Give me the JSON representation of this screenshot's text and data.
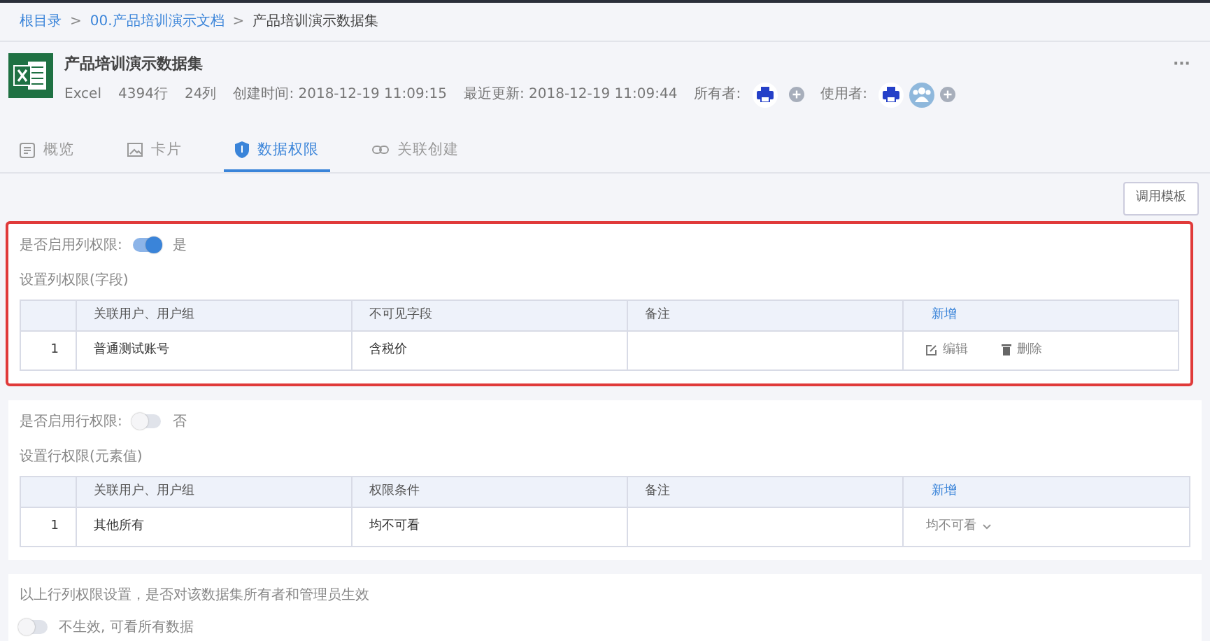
{
  "breadcrumb": [
    {
      "label": "根目录",
      "link": true
    },
    {
      "label": "00.产品培训演示文档",
      "link": true
    },
    {
      "label": "产品培训演示数据集",
      "link": false
    }
  ],
  "breadcrumb_separator": ">",
  "dataset": {
    "title": "产品培训演示数据集",
    "type": "Excel",
    "rows": "4394行",
    "columns": "24列",
    "created_label": "创建时间:",
    "created": "2018-12-19 11:09:15",
    "updated_label": "最近更新:",
    "updated": "2018-12-19 11:09:44",
    "owner_label": "所有者:",
    "user_label": "使用者:",
    "more": "···"
  },
  "tabs": [
    {
      "label": "概览",
      "selected": false
    },
    {
      "label": "卡片",
      "selected": false
    },
    {
      "label": "数据权限",
      "selected": true
    },
    {
      "label": "关联创建",
      "selected": false
    }
  ],
  "template_button": "调用模板",
  "sections": [
    {
      "toggle_label": "是否启用列权限:",
      "on": true,
      "state_text": "是",
      "subtitle": "设置列权限(字段)",
      "highlighted": true,
      "columns": [
        "关联用户、用户组",
        "不可见字段",
        "备注"
      ],
      "add": "新增",
      "rows": [
        {
          "index": "1",
          "cells": [
            "普通测试账号",
            "含税价",
            ""
          ],
          "kind": "actions",
          "actions": [
            "编辑",
            "删除"
          ]
        }
      ]
    },
    {
      "toggle_label": "是否启用行权限:",
      "on": false,
      "state_text": "否",
      "subtitle": "设置行权限(元素值)",
      "highlighted": false,
      "columns": [
        "关联用户、用户组",
        "权限条件",
        "备注"
      ],
      "add": "新增",
      "rows": [
        {
          "index": "1",
          "cells": [
            "其他所有",
            "均不可看",
            ""
          ],
          "kind": "select",
          "select": "均不可看"
        }
      ]
    }
  ],
  "owner_scope": {
    "question": "以上行列权限设置，是否对该数据集所有者和管理员生效",
    "on": false,
    "state_text": "不生效, 可看所有数据"
  }
}
